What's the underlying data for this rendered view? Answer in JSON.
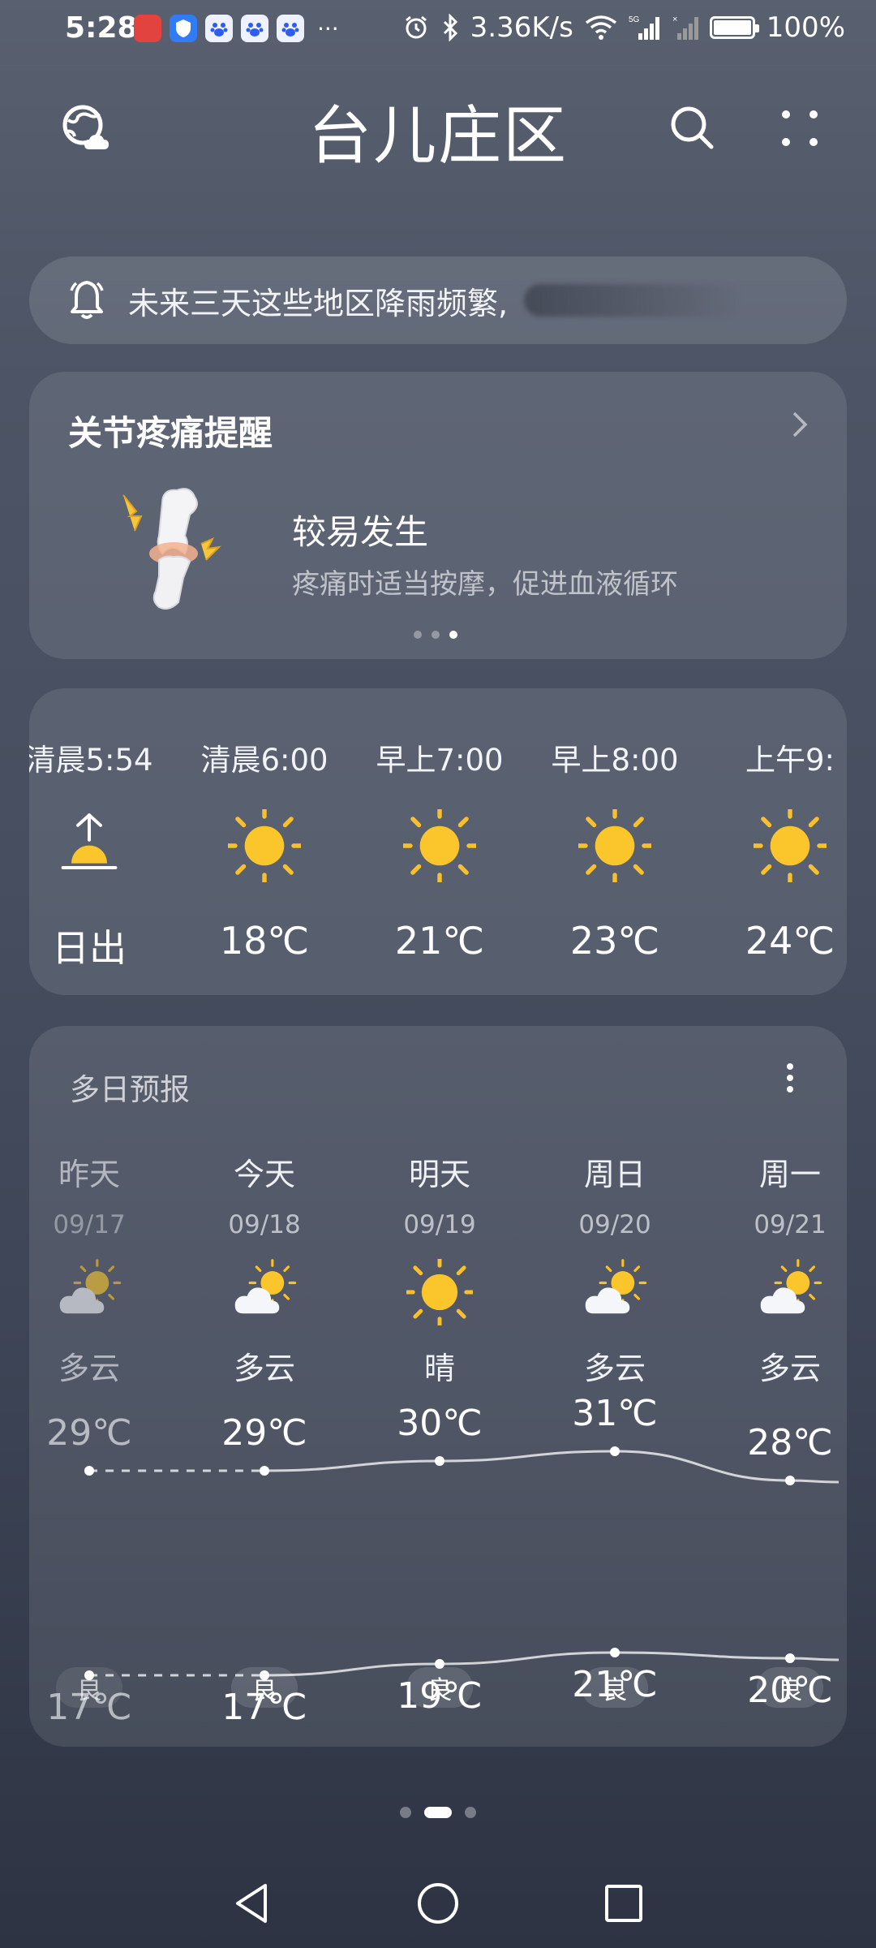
{
  "status_bar": {
    "time": "5:28",
    "overflow": "···",
    "network_speed": "3.36K/s",
    "battery": "100%",
    "battery_level": 1.0,
    "icons": [
      "huawei-store-icon",
      "shield-icon",
      "baidu-icon",
      "baidu-icon",
      "baidu-icon",
      "alarm-icon",
      "bluetooth-icon",
      "wifi-icon",
      "signal-5g-icon",
      "signal-no-sim-icon",
      "battery-icon"
    ]
  },
  "header": {
    "city": "台儿庄区",
    "left_icon": "globe-cloud-icon",
    "search_icon": "search-icon",
    "menu_icon": "more-dots-icon"
  },
  "alert": {
    "icon": "bell-icon",
    "text": "未来三天这些地区降雨频繁,"
  },
  "joint_pain": {
    "title": "关节疼痛提醒",
    "level": "较易发生",
    "tip": "疼痛时适当按摩，促进血液循环",
    "carousel_active": 2,
    "carousel_count": 3
  },
  "hourly": [
    {
      "time": "清晨5:54",
      "icon": "sunrise-icon",
      "value": "日出"
    },
    {
      "time": "清晨6:00",
      "icon": "sun-icon",
      "value": "18℃"
    },
    {
      "time": "早上7:00",
      "icon": "sun-icon",
      "value": "21℃"
    },
    {
      "time": "早上8:00",
      "icon": "sun-icon",
      "value": "23℃"
    },
    {
      "time": "上午9:",
      "icon": "sun-icon",
      "value": "24℃"
    }
  ],
  "daily": {
    "title": "多日预报",
    "menu_icon": "vertical-dots-icon",
    "days": [
      {
        "name": "昨天",
        "date": "09/17",
        "icon": "partly-cloudy-icon",
        "cond": "多云",
        "high": 29,
        "high_label": "29℃",
        "low": 17,
        "low_label": "17℃",
        "aqi": "良",
        "past": true
      },
      {
        "name": "今天",
        "date": "09/18",
        "icon": "partly-cloudy-icon",
        "cond": "多云",
        "high": 29,
        "high_label": "29℃",
        "low": 17,
        "low_label": "17℃",
        "aqi": "良",
        "past": false
      },
      {
        "name": "明天",
        "date": "09/19",
        "icon": "sun-icon",
        "cond": "晴",
        "high": 30,
        "high_label": "30℃",
        "low": 19,
        "low_label": "19℃",
        "aqi": "良",
        "past": false
      },
      {
        "name": "周日",
        "date": "09/20",
        "icon": "partly-cloudy-icon",
        "cond": "多云",
        "high": 31,
        "high_label": "31℃",
        "low": 21,
        "low_label": "21℃",
        "aqi": "良",
        "past": false
      },
      {
        "name": "周一",
        "date": "09/21",
        "icon": "partly-cloudy-icon",
        "cond": "多云",
        "high": 28,
        "high_label": "28℃",
        "low": 20,
        "low_label": "20℃",
        "aqi": "良",
        "past": false
      }
    ]
  },
  "pager": {
    "active": 1,
    "count": 3
  },
  "nav": {
    "back_icon": "back-triangle-icon",
    "home_icon": "home-circle-icon",
    "recent_icon": "recents-square-icon"
  }
}
